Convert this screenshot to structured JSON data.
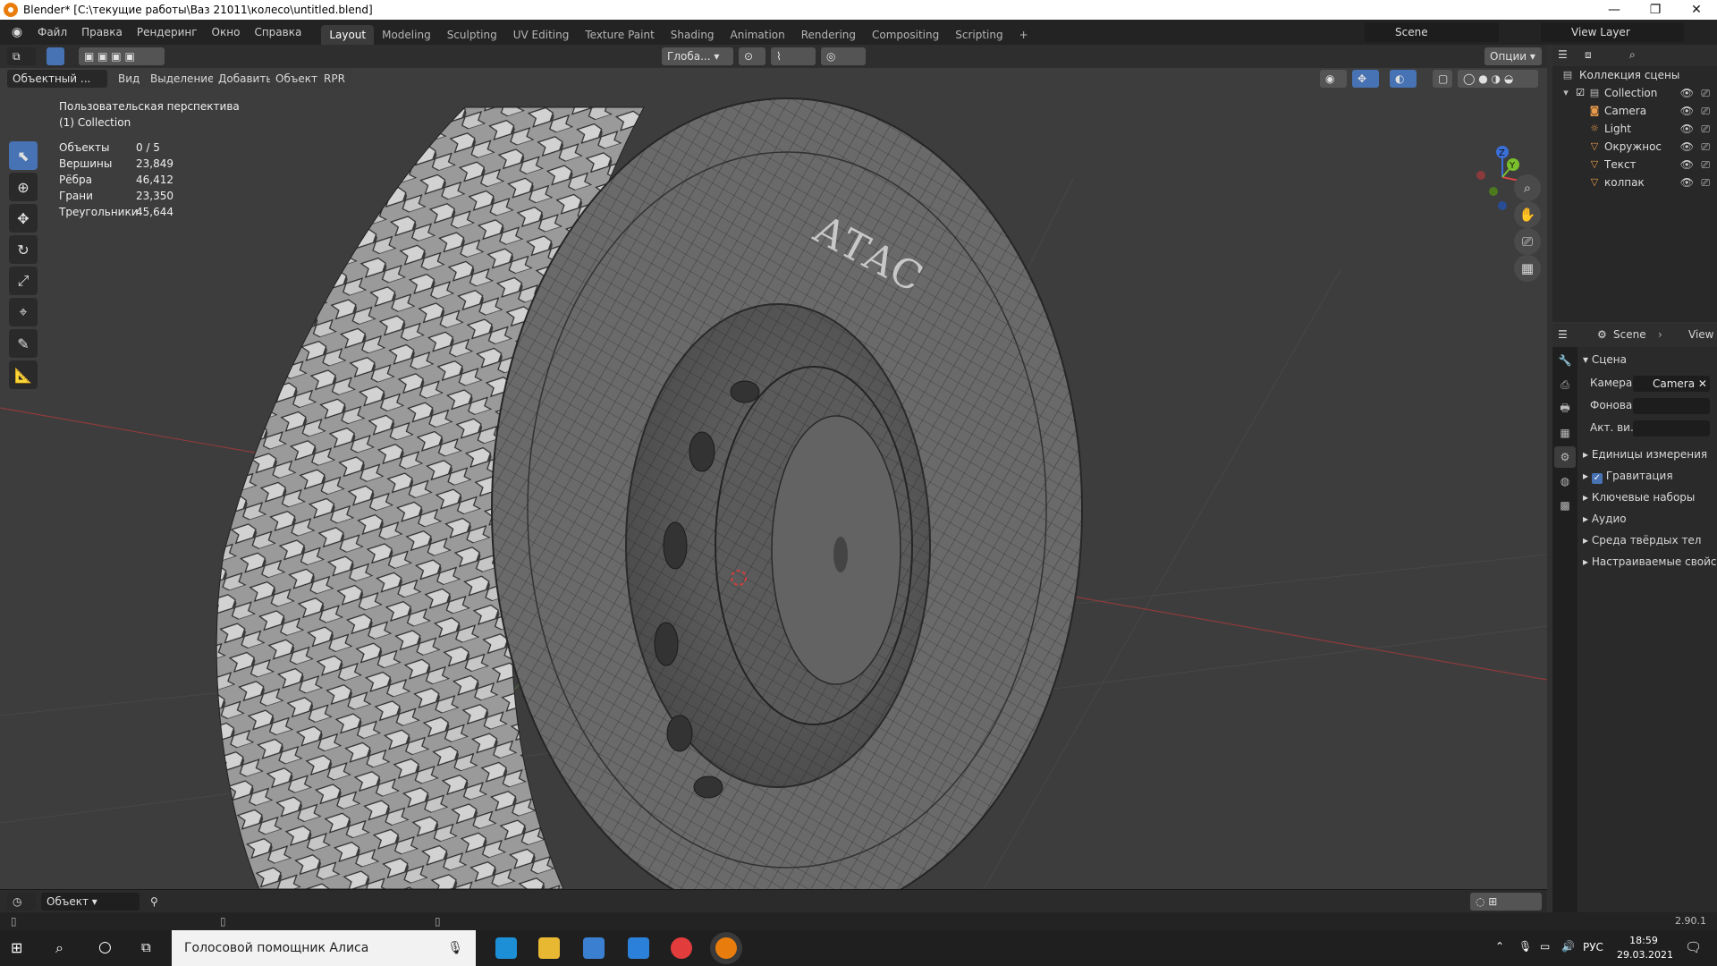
{
  "window": {
    "title": "Blender* [C:\\текущие работы\\Ваз 21011\\колесо\\untitled.blend]",
    "minimize": "—",
    "maximize": "❐",
    "close": "✕"
  },
  "menu": [
    "Файл",
    "Правка",
    "Рендеринг",
    "Окно",
    "Справка"
  ],
  "workspaces": [
    "Layout",
    "Modeling",
    "Sculpting",
    "UV Editing",
    "Texture Paint",
    "Shading",
    "Animation",
    "Rendering",
    "Compositing",
    "Scripting"
  ],
  "active_workspace": "Layout",
  "add_workspace": "+",
  "scene_name": "Scene",
  "view_layer": "View Layer",
  "viewport": {
    "mode": "Объектный ...",
    "menus": [
      "Вид",
      "Выделение",
      "Добавить",
      "Объект",
      "RPR"
    ],
    "orientation": "Глоба...",
    "options": "Опции",
    "overlay_title": "Пользовательская перспектива",
    "overlay_collection": "(1) Collection",
    "stats": [
      {
        "label": "Объекты",
        "value": "0 / 5"
      },
      {
        "label": "Вершины",
        "value": "23,849"
      },
      {
        "label": "Рёбра",
        "value": "46,412"
      },
      {
        "label": "Грани",
        "value": "23,350"
      },
      {
        "label": "Треугольники",
        "value": "45,644"
      }
    ],
    "tire_text": "АТАС",
    "axis_x": "X",
    "axis_y": "Y",
    "axis_z": "Z"
  },
  "timeline": {
    "mode": "Объект"
  },
  "outliner": {
    "root": "Коллекция сцены",
    "collection": "Collection",
    "items": [
      "Camera",
      "Light",
      "Окружнос",
      "Текст",
      "колпак"
    ]
  },
  "properties": {
    "breadcrumb_scene": "Scene",
    "breadcrumb_view": "View",
    "section": "Сцена",
    "camera_label": "Камера",
    "camera_value": "Camera",
    "background_label": "Фонова...",
    "active_clip_label": "Акт. ви...",
    "panels": [
      "Единицы измерения",
      "Гравитация",
      "Ключевые наборы",
      "Аудио",
      "Среда твёрдых тел",
      "Настраиваемые свойс"
    ]
  },
  "status": {
    "version": "2.90.1"
  },
  "taskbar": {
    "search_text": "Голосовой помощник Алиса",
    "lang": "РУС",
    "time": "18:59",
    "date": "29.03.2021"
  }
}
